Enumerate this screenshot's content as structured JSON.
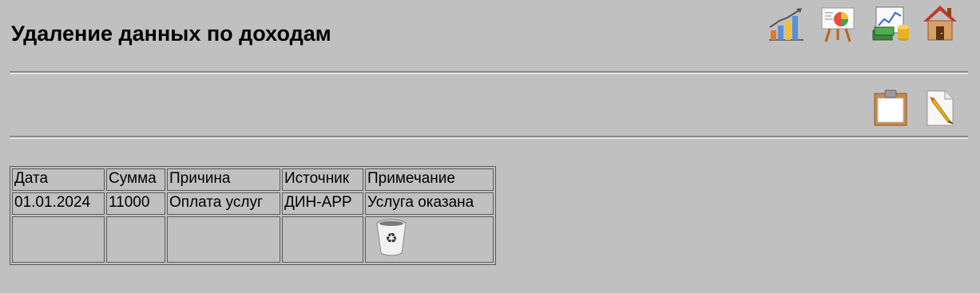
{
  "page": {
    "title": "Удаление данных по доходам"
  },
  "top_icons": [
    "bar-chart-icon",
    "presentation-pie-icon",
    "money-chart-icon",
    "home-icon"
  ],
  "toolbar_icons": [
    "clipboard-icon",
    "edit-pencil-icon"
  ],
  "table": {
    "headers": [
      "Дата",
      "Сумма",
      "Причина",
      "Источник",
      "Примечание"
    ],
    "row": [
      "01.01.2024",
      "11000",
      "Оплата услуг",
      "ДИН-АРР",
      "Услуга оказана"
    ]
  },
  "action_icon": "recycle-bin-icon"
}
